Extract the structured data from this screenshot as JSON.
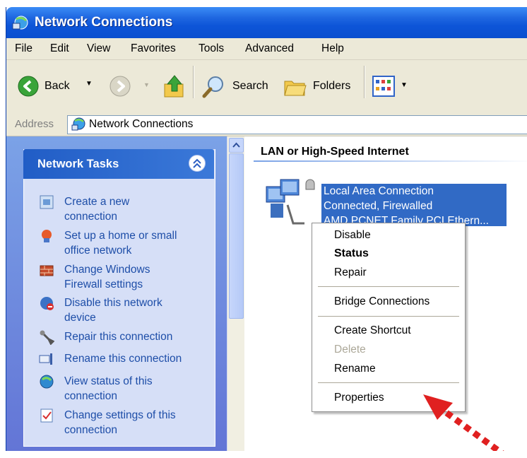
{
  "window": {
    "title": "Network Connections"
  },
  "menubar": {
    "items": [
      "File",
      "Edit",
      "View",
      "Favorites",
      "Tools",
      "Advanced",
      "Help"
    ]
  },
  "toolbar": {
    "back_label": "Back",
    "search_label": "Search",
    "folders_label": "Folders"
  },
  "address": {
    "label": "Address",
    "value": "Network Connections"
  },
  "tasks_panel": {
    "title": "Network Tasks",
    "items": [
      {
        "line1": "Create a new",
        "line2": "connection",
        "icon": "new-connection-icon"
      },
      {
        "line1": "Set up a home or small",
        "line2": "office network",
        "icon": "home-network-icon"
      },
      {
        "line1": "Change Windows",
        "line2": "Firewall settings",
        "icon": "firewall-icon"
      },
      {
        "line1": "Disable this network",
        "line2": "device",
        "icon": "disable-network-icon"
      },
      {
        "line1": "Repair this connection",
        "line2": "",
        "icon": "repair-icon"
      },
      {
        "line1": "Rename this connection",
        "line2": "",
        "icon": "rename-icon"
      },
      {
        "line1": "View status of this",
        "line2": "connection",
        "icon": "status-icon"
      },
      {
        "line1": "Change settings of this",
        "line2": "connection",
        "icon": "settings-icon"
      }
    ]
  },
  "content": {
    "group_header": "LAN or High-Speed Internet",
    "connection": {
      "name": "Local Area Connection",
      "status": "Connected, Firewalled",
      "device": "AMD PCNET Family PCI Ethern..."
    }
  },
  "context_menu": {
    "disable": "Disable",
    "status": "Status",
    "repair": "Repair",
    "bridge": "Bridge Connections",
    "shortcut": "Create Shortcut",
    "delete": "Delete",
    "rename": "Rename",
    "properties": "Properties"
  },
  "colors": {
    "title_bar": "#0d55d8",
    "selection": "#316ac5",
    "task_link": "#1e4ea8",
    "annotation_arrow": "#e02020"
  }
}
